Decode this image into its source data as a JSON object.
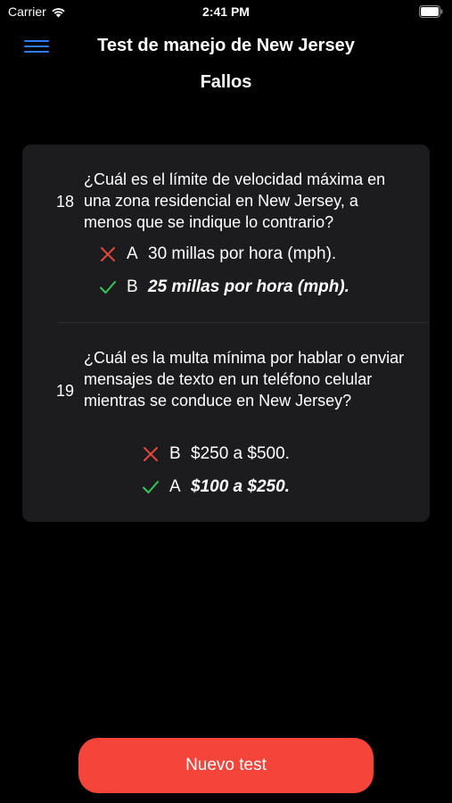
{
  "status_bar": {
    "carrier": "Carrier",
    "time": "2:41 PM",
    "icons": [
      "wifi-icon",
      "battery-icon"
    ]
  },
  "header": {
    "menu_icon": "hamburger-menu-icon",
    "title": "Test de manejo de New Jersey",
    "subtitle": "Fallos"
  },
  "questions": [
    {
      "number": "18",
      "text": "¿Cuál es el límite de velocidad máxima en una zona residencial en New Jersey, a menos que se indique lo contrario?",
      "wrong": {
        "letter": "A",
        "text": "30 millas por hora (mph)."
      },
      "correct": {
        "letter": "B",
        "text": "25 millas por hora (mph)."
      }
    },
    {
      "number": "19",
      "text": "¿Cuál es la multa mínima por hablar o enviar mensajes de texto en un teléfono celular mientras se conduce en New Jersey?",
      "wrong": {
        "letter": "B",
        "text": "$250 a $500."
      },
      "correct": {
        "letter": "A",
        "text": "$100 a $250."
      }
    }
  ],
  "button": {
    "label": "Nuevo test"
  },
  "colors": {
    "accent": "#2f7cf6",
    "wrong": "#e5483d",
    "correct": "#34c759",
    "button": "#f5453b",
    "card": "#1c1c1e"
  }
}
